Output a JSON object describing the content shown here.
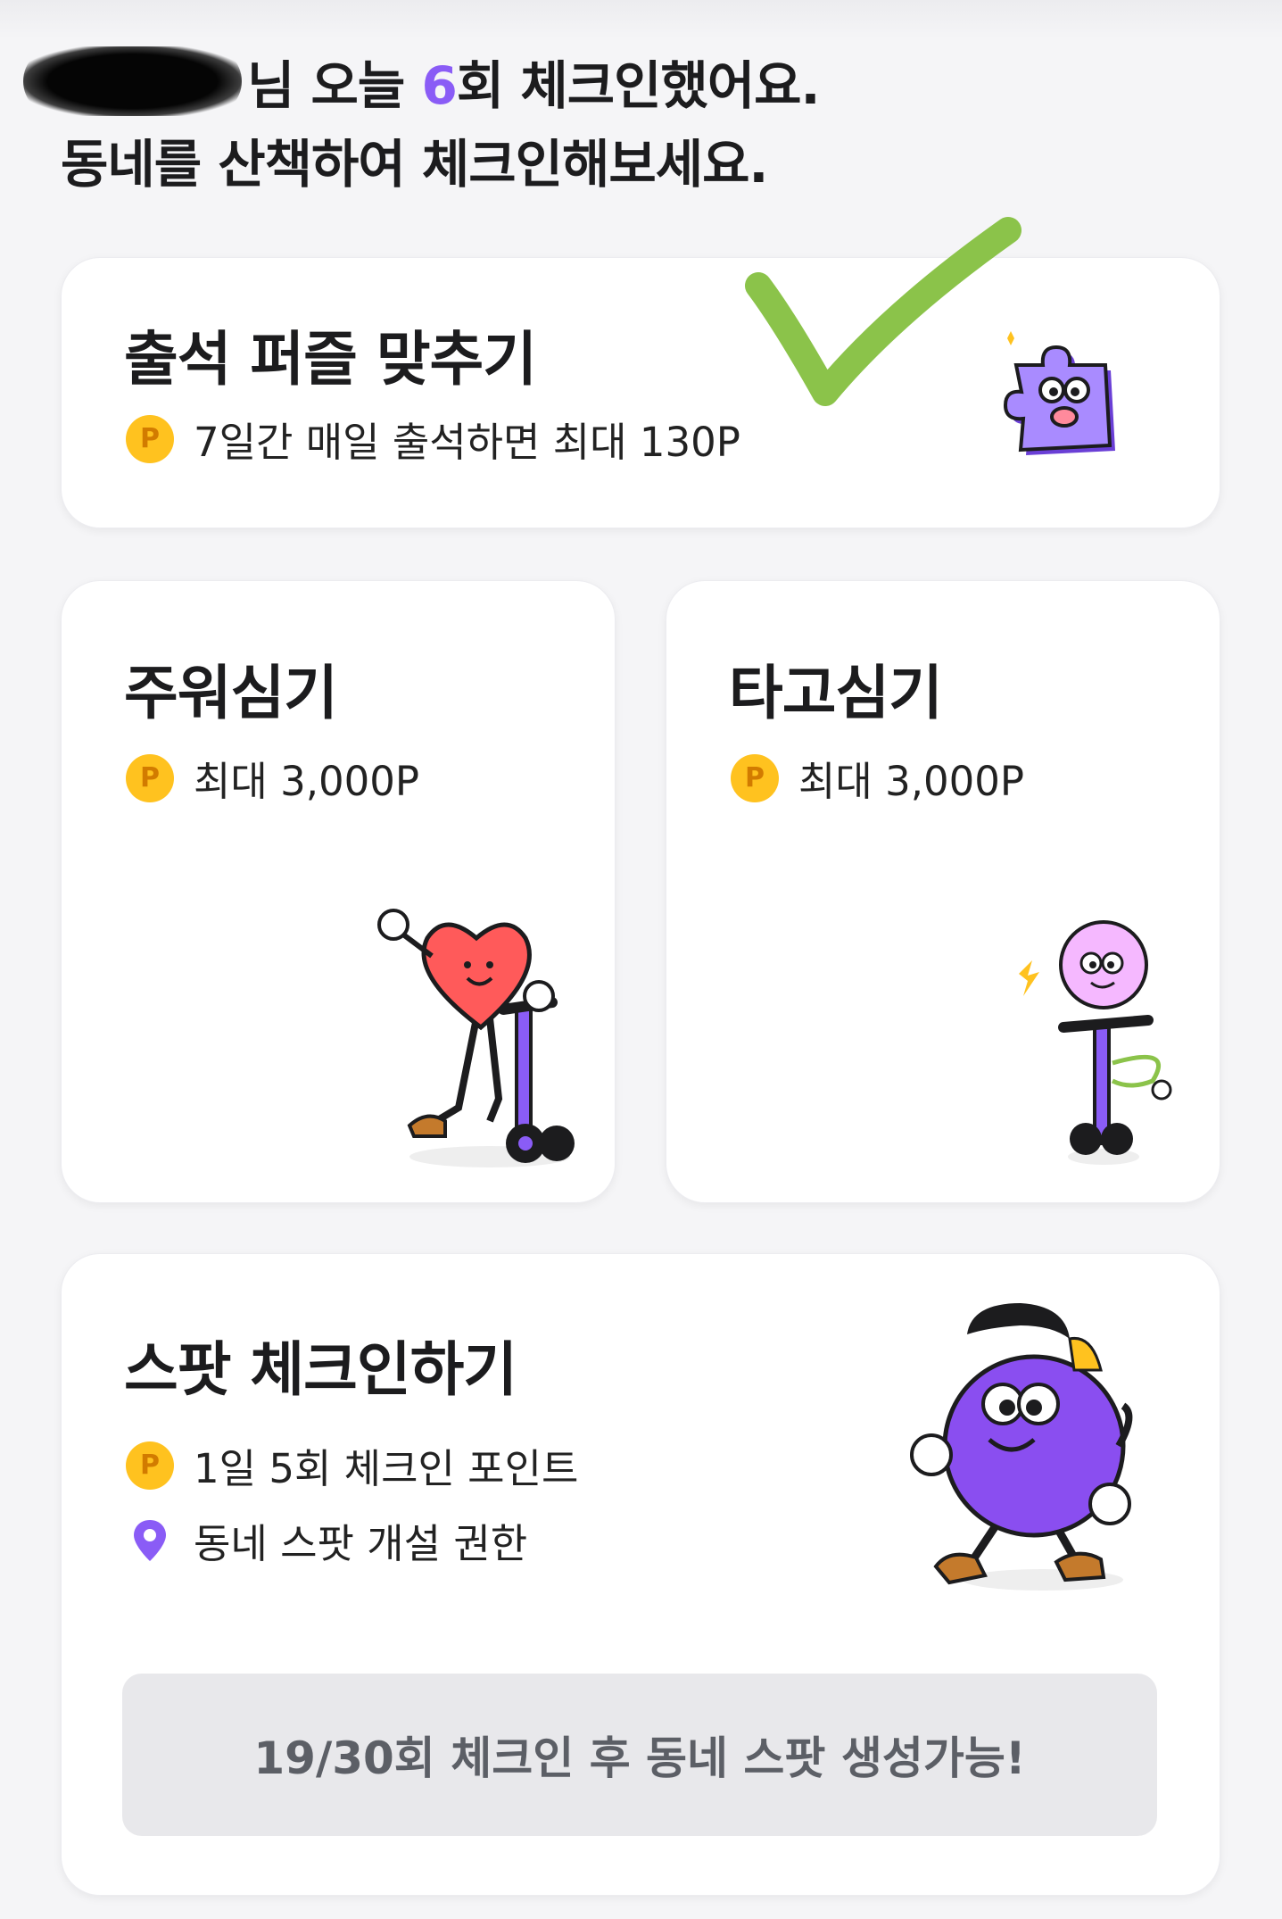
{
  "header": {
    "line1_suffix_pre": "님 오늘 ",
    "checkin_count": "6",
    "line1_suffix_post": "회 체크인했어요.",
    "line2": "동네를 산책하여 체크인해보세요."
  },
  "attendance": {
    "title": "출석 퍼즐 맞추기",
    "reward": "7일간 매일 출석하면 최대 130P"
  },
  "walk": {
    "title": "주워심기",
    "reward": "최대 3,000P"
  },
  "ride": {
    "title": "타고심기",
    "reward": "최대 3,000P"
  },
  "spot": {
    "title": "스팟 체크인하기",
    "benefit_points": "1일 5회 체크인 포인트",
    "benefit_spot": "동네 스팟 개설 권한",
    "progress_message": "19/30회 체크인 후 동네 스팟 생성가능!"
  },
  "icons": {
    "coin_letter": "P",
    "coin_color": "#ffc21f",
    "pin_color": "#8a5cf6",
    "accent_color": "#8a5cf6",
    "check_color": "#8bc34a"
  }
}
